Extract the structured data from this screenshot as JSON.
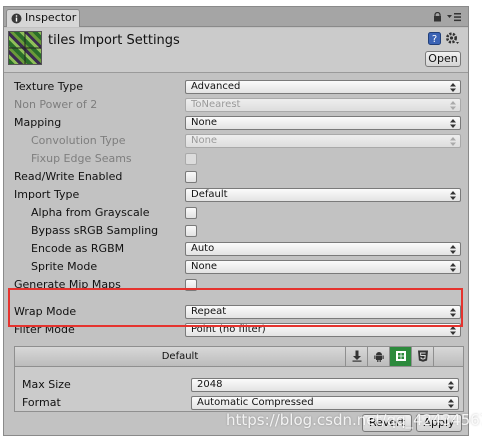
{
  "tab": {
    "label": "Inspector"
  },
  "header": {
    "title": "tiles Import Settings",
    "open_label": "Open"
  },
  "fields": [
    {
      "label": "Texture Type",
      "kind": "dropdown",
      "value": "Advanced",
      "disabled": false
    },
    {
      "label": "Non Power of 2",
      "kind": "dropdown",
      "value": "ToNearest",
      "disabled": true
    },
    {
      "label": "Mapping",
      "kind": "dropdown",
      "value": "None",
      "disabled": false
    },
    {
      "label": "Convolution Type",
      "kind": "dropdown",
      "value": "None",
      "disabled": true
    },
    {
      "label": "Fixup Edge Seams",
      "kind": "checkbox",
      "checked": false,
      "disabled": true
    },
    {
      "label": "Read/Write Enabled",
      "kind": "checkbox",
      "checked": false,
      "disabled": false
    },
    {
      "label": "Import Type",
      "kind": "dropdown",
      "value": "Default",
      "disabled": false
    },
    {
      "label": "Alpha from Grayscale",
      "kind": "checkbox",
      "checked": false,
      "disabled": false
    },
    {
      "label": "Bypass sRGB Sampling",
      "kind": "checkbox",
      "checked": false,
      "disabled": false
    },
    {
      "label": "Encode as RGBM",
      "kind": "dropdown",
      "value": "Auto",
      "disabled": false
    },
    {
      "label": "Sprite Mode",
      "kind": "dropdown",
      "value": "None",
      "disabled": false
    },
    {
      "label": "Generate Mip Maps",
      "kind": "checkbox",
      "checked": false,
      "disabled": false
    },
    {
      "label": "Wrap Mode",
      "kind": "dropdown",
      "value": "Repeat",
      "disabled": false
    },
    {
      "label": "Filter Mode",
      "kind": "dropdown",
      "value": "Point (no filter)",
      "disabled": false
    }
  ],
  "platform": {
    "default_tab": "Default",
    "max_size_label": "Max Size",
    "max_size_value": "2048",
    "format_label": "Format",
    "format_value": "Automatic Compressed"
  },
  "buttons": {
    "revert": "Revert",
    "apply": "Apply"
  },
  "watermark": "https://blog.csdn.net/qq_42434567",
  "colors": {
    "highlight": "#e5332e",
    "active_platform": "#2c8a3c"
  }
}
